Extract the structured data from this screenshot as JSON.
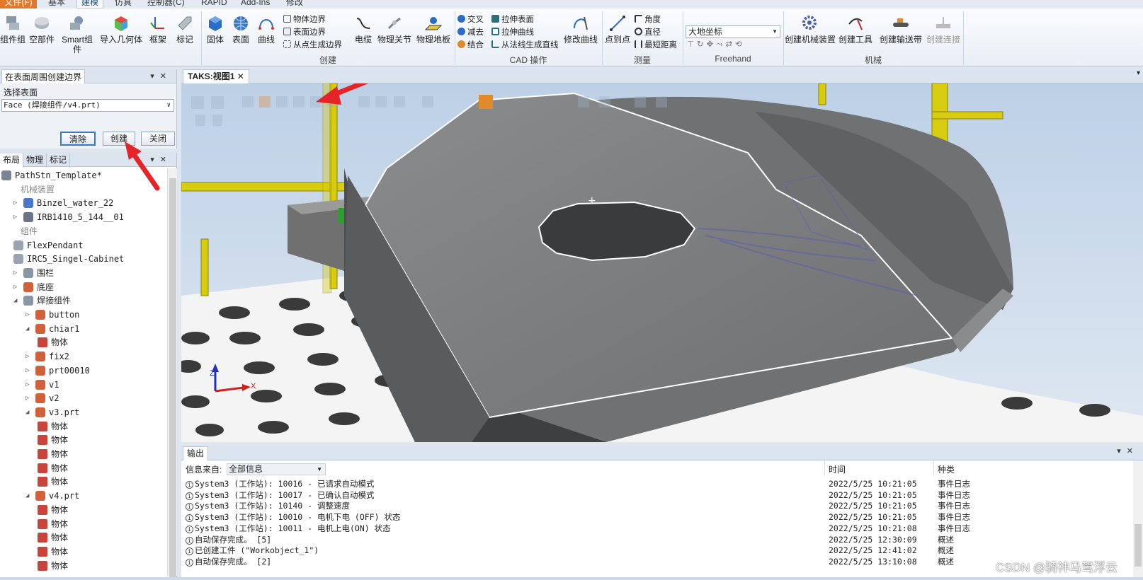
{
  "ribbon": {
    "tabs": [
      "文件(F)",
      "基本",
      "建模",
      "仿真",
      "控制器(C)",
      "RAPID",
      "Add-Ins",
      "修改"
    ],
    "groups": {
      "create": "创建",
      "cad": "CAD 操作",
      "measure": "测量",
      "freehand": "Freehand",
      "mechanism": "机械"
    },
    "buttons": {
      "component_group": "组件组",
      "empty_part": "空部件",
      "smart_component": "Smart组件",
      "import_geometry": "导入几何体",
      "frame": "框架",
      "tag": "标记",
      "solid": "固体",
      "surface": "表面",
      "curve": "曲线",
      "cable": "电缆",
      "physics_joint": "物理关节",
      "physics_floor": "物理地板",
      "modify_curve": "修改曲线",
      "point_to_point": "点到点",
      "create_mechanism": "创建机械装置",
      "create_tool": "创建工具",
      "create_conveyor": "创建输送带",
      "create_connection": "创建连接"
    },
    "small_buttons": {
      "object_border": "物体边界",
      "surface_border": "表面边界",
      "border_from_points": "从点生成边界",
      "intersect": "交叉",
      "subtract": "减去",
      "union": "结合",
      "extrude_surface": "拉伸表面",
      "extrude_curve": "拉伸曲线",
      "line_from_normal": "从法线生成直线",
      "angle": "角度",
      "diameter": "直径",
      "shortest_distance": "最短距离"
    },
    "coord_select": "大地坐标"
  },
  "left_panel": {
    "title": "在表面周围创建边界",
    "select_label": "选择表面",
    "face_value": "Face (焊接组件/v4.prt)",
    "clear": "清除",
    "create": "创建",
    "close": "关闭"
  },
  "tree": {
    "tabs": [
      "布局",
      "物理",
      "标记"
    ],
    "items": [
      {
        "label": "PathStn_Template*",
        "indent": 0,
        "twisty": "",
        "icon": "station-icon",
        "category": false
      },
      {
        "label": "机械装置",
        "indent": 1,
        "twisty": "",
        "icon": "",
        "category": true
      },
      {
        "label": "Binzel_water_22",
        "indent": 1,
        "twisty": "▷",
        "icon": "tool-icon",
        "category": false
      },
      {
        "label": "IRB1410_5_144__01",
        "indent": 1,
        "twisty": "▷",
        "icon": "robot-icon",
        "category": false
      },
      {
        "label": "组件",
        "indent": 1,
        "twisty": "",
        "icon": "",
        "category": true
      },
      {
        "label": "FlexPendant",
        "indent": 1,
        "twisty": "",
        "icon": "part-icon",
        "category": false
      },
      {
        "label": "IRC5_Singel-Cabinet",
        "indent": 1,
        "twisty": "",
        "icon": "part-icon",
        "category": false
      },
      {
        "label": "围栏",
        "indent": 1,
        "twisty": "▷",
        "icon": "group-icon",
        "category": false
      },
      {
        "label": "底座",
        "indent": 1,
        "twisty": "▷",
        "icon": "component-icon",
        "category": false
      },
      {
        "label": "焊接组件",
        "indent": 1,
        "twisty": "◢",
        "icon": "group-icon",
        "category": false
      },
      {
        "label": "button",
        "indent": 2,
        "twisty": "▷",
        "icon": "component-icon",
        "category": false
      },
      {
        "label": "chiar1",
        "indent": 2,
        "twisty": "◢",
        "icon": "component-icon",
        "category": false
      },
      {
        "label": "物体",
        "indent": 3,
        "twisty": "",
        "icon": "body-icon",
        "category": false
      },
      {
        "label": "fix2",
        "indent": 2,
        "twisty": "▷",
        "icon": "component-icon",
        "category": false
      },
      {
        "label": "prt00010",
        "indent": 2,
        "twisty": "▷",
        "icon": "component-icon",
        "category": false
      },
      {
        "label": "v1",
        "indent": 2,
        "twisty": "▷",
        "icon": "component-icon",
        "category": false
      },
      {
        "label": "v2",
        "indent": 2,
        "twisty": "▷",
        "icon": "component-icon",
        "category": false
      },
      {
        "label": "v3.prt",
        "indent": 2,
        "twisty": "◢",
        "icon": "component-icon",
        "category": false
      },
      {
        "label": "物体",
        "indent": 3,
        "twisty": "",
        "icon": "body-icon",
        "category": false
      },
      {
        "label": "物体",
        "indent": 3,
        "twisty": "",
        "icon": "body-icon",
        "category": false
      },
      {
        "label": "物体",
        "indent": 3,
        "twisty": "",
        "icon": "body-icon",
        "category": false
      },
      {
        "label": "物体",
        "indent": 3,
        "twisty": "",
        "icon": "body-icon",
        "category": false
      },
      {
        "label": "物体",
        "indent": 3,
        "twisty": "",
        "icon": "body-icon",
        "category": false
      },
      {
        "label": "v4.prt",
        "indent": 2,
        "twisty": "◢",
        "icon": "component-icon",
        "category": false
      },
      {
        "label": "物体",
        "indent": 3,
        "twisty": "",
        "icon": "body-icon",
        "category": false
      },
      {
        "label": "物体",
        "indent": 3,
        "twisty": "",
        "icon": "body-icon",
        "category": false
      },
      {
        "label": "物体",
        "indent": 3,
        "twisty": "",
        "icon": "body-icon",
        "category": false
      },
      {
        "label": "物体",
        "indent": 3,
        "twisty": "",
        "icon": "body-icon",
        "category": false
      },
      {
        "label": "物体",
        "indent": 3,
        "twisty": "",
        "icon": "body-icon",
        "category": false
      }
    ]
  },
  "viewport": {
    "tab": "TAKS:视图1",
    "axis_z": "Z",
    "axis_x": "X"
  },
  "output": {
    "title": "输出",
    "source_label": "信息来自:",
    "source_value": "全部信息",
    "col_time": "时间",
    "col_kind": "种类",
    "rows": [
      {
        "msg": "System3 (工作站): 10016 - 已请求自动模式",
        "time": "2022/5/25 10:21:05",
        "kind": "事件日志"
      },
      {
        "msg": "System3 (工作站): 10017 - 已确认自动模式",
        "time": "2022/5/25 10:21:05",
        "kind": "事件日志"
      },
      {
        "msg": "System3 (工作站): 10140 - 调整速度",
        "time": "2022/5/25 10:21:05",
        "kind": "事件日志"
      },
      {
        "msg": "System3 (工作站): 10010 - 电机下电 (OFF) 状态",
        "time": "2022/5/25 10:21:05",
        "kind": "事件日志"
      },
      {
        "msg": "System3 (工作站): 10011 - 电机上电(ON) 状态",
        "time": "2022/5/25 10:21:08",
        "kind": "事件日志"
      },
      {
        "msg": "自动保存完成。 [5]",
        "time": "2022/5/25 12:30:09",
        "kind": "概述"
      },
      {
        "msg": "已创建工件 (\"Workobject_1\")",
        "time": "2022/5/25 12:41:02",
        "kind": "概述"
      },
      {
        "msg": "自动保存完成。 [2]",
        "time": "2022/5/25 13:10:08",
        "kind": "概述"
      }
    ]
  },
  "watermark": "CSDN @骑神马驾浮云",
  "colors": {
    "annotation_arrow": "#e5242a",
    "file_tab": "#e4782a",
    "frame_bar": "#d8cc10"
  }
}
